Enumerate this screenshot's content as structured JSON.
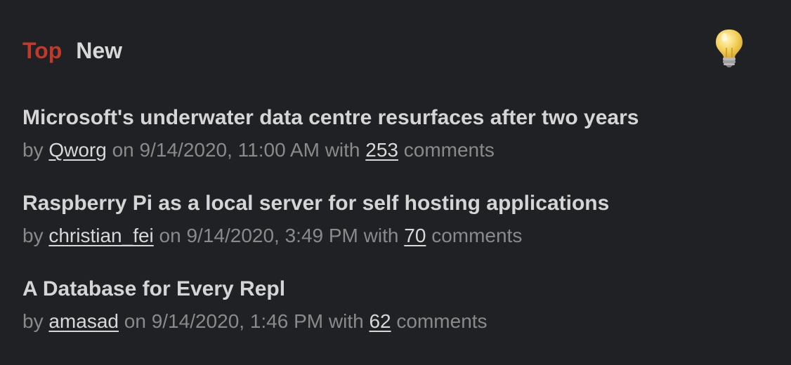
{
  "tabs": {
    "top_label": "Top",
    "new_label": "New"
  },
  "theme_toggle": {
    "icon": "lightbulb-icon",
    "bulb_color": "#f3d25c"
  },
  "colors": {
    "background": "#1f2124",
    "accent": "#c0392b",
    "title": "#d5d5d5",
    "meta": "#8a8a8a"
  },
  "meta_words": {
    "by": "by",
    "on": "on",
    "with": "with",
    "comments": "comments"
  },
  "stories": [
    {
      "title": "Microsoft's underwater data centre resurfaces after two years",
      "author": "Qworg",
      "date": "9/14/2020, 11:00 AM",
      "comments": "253"
    },
    {
      "title": "Raspberry Pi as a local server for self hosting applications",
      "author": "christian_fei",
      "date": "9/14/2020, 3:49 PM",
      "comments": "70"
    },
    {
      "title": "A Database for Every Repl",
      "author": "amasad",
      "date": "9/14/2020, 1:46 PM",
      "comments": "62"
    }
  ]
}
